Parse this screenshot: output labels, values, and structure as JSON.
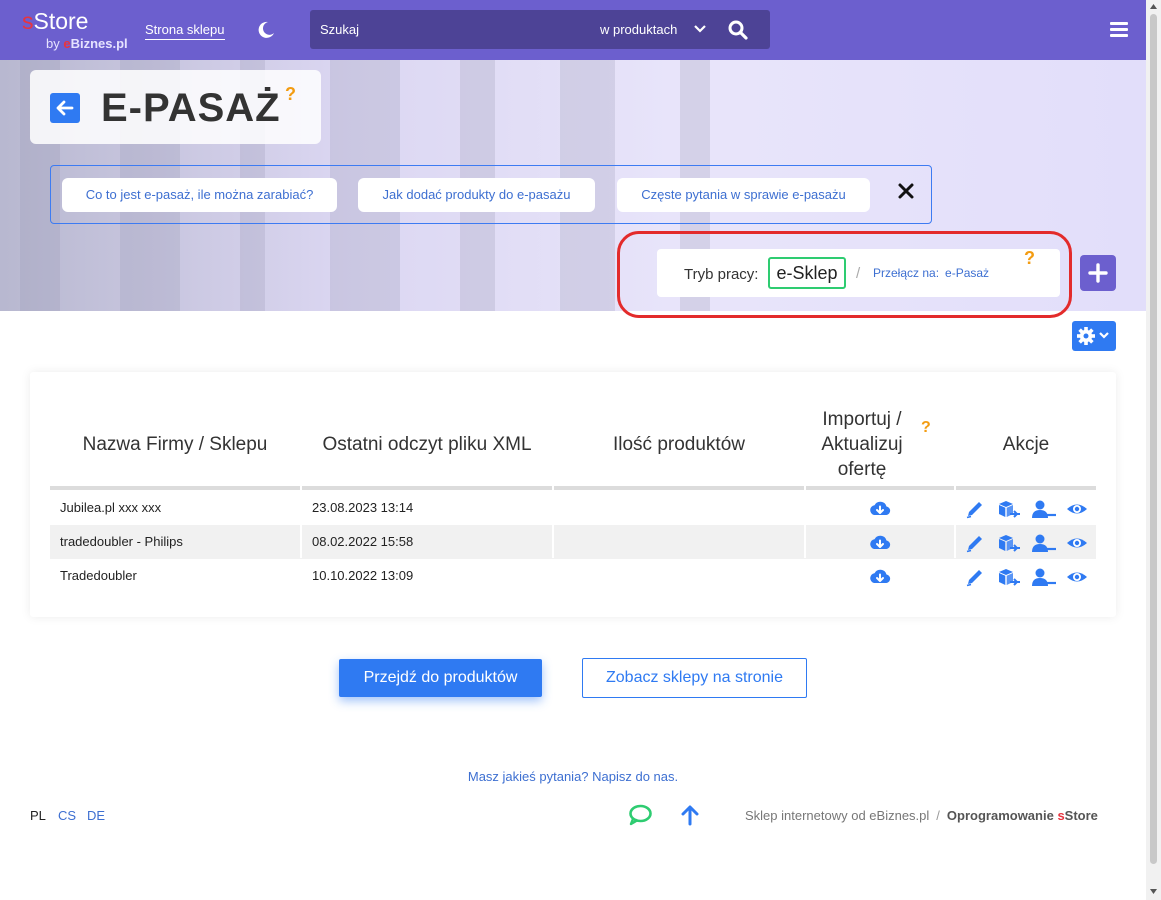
{
  "header": {
    "logo_main": "Store",
    "logo_s": "s",
    "logo_by": "by ",
    "logo_by_e": "e",
    "logo_by_domain": "Biznes.pl",
    "shop_link": "Strona sklepu",
    "search_placeholder": "Szukaj",
    "search_scope": "w produktach",
    "accent_color": "#6c5fce"
  },
  "page": {
    "title": "E-PASAŻ",
    "help_mark": "?"
  },
  "faq": {
    "items": [
      "Co to jest e-pasaż, ile można zarabiać?",
      "Jak dodać produkty do e-pasażu",
      "Częste pytania w sprawie e-pasażu"
    ]
  },
  "mode": {
    "label": "Tryb pracy:",
    "current": "e-Sklep",
    "separator": "/",
    "switch_label": "Przełącz na:",
    "switch_target": "e-Pasaż",
    "help_mark": "?"
  },
  "table": {
    "columns": [
      "Nazwa Firmy / Sklepu",
      "Ostatni odczyt pliku XML",
      "Ilość produktów",
      "Importuj / Aktualizuj ofertę",
      "Akcje"
    ],
    "import_help": "?",
    "rows": [
      {
        "name": "Jubilea.pl xxx xxx",
        "last_read": "23.08.2023 13:14",
        "count": ""
      },
      {
        "name": "tradedoubler - Philips",
        "last_read": "08.02.2022 15:58",
        "count": ""
      },
      {
        "name": "Tradedoubler",
        "last_read": "10.10.2022 13:09",
        "count": ""
      }
    ],
    "row_icons": [
      "download-cloud-icon",
      "pencil-icon",
      "box-icon",
      "user-icon",
      "eye-icon"
    ]
  },
  "buttons": {
    "products": "Przejdź do produktów",
    "shops": "Zobacz sklepy na stronie"
  },
  "footer": {
    "contact": "Masz jakieś pytania? Napisz do nas.",
    "languages": [
      "PL",
      "CS",
      "DE"
    ],
    "credit": "Sklep internetowy od eBiznes.pl",
    "sep": "/",
    "software": "Oprogramowanie ",
    "software_s": "s",
    "software_brand": "Store"
  }
}
